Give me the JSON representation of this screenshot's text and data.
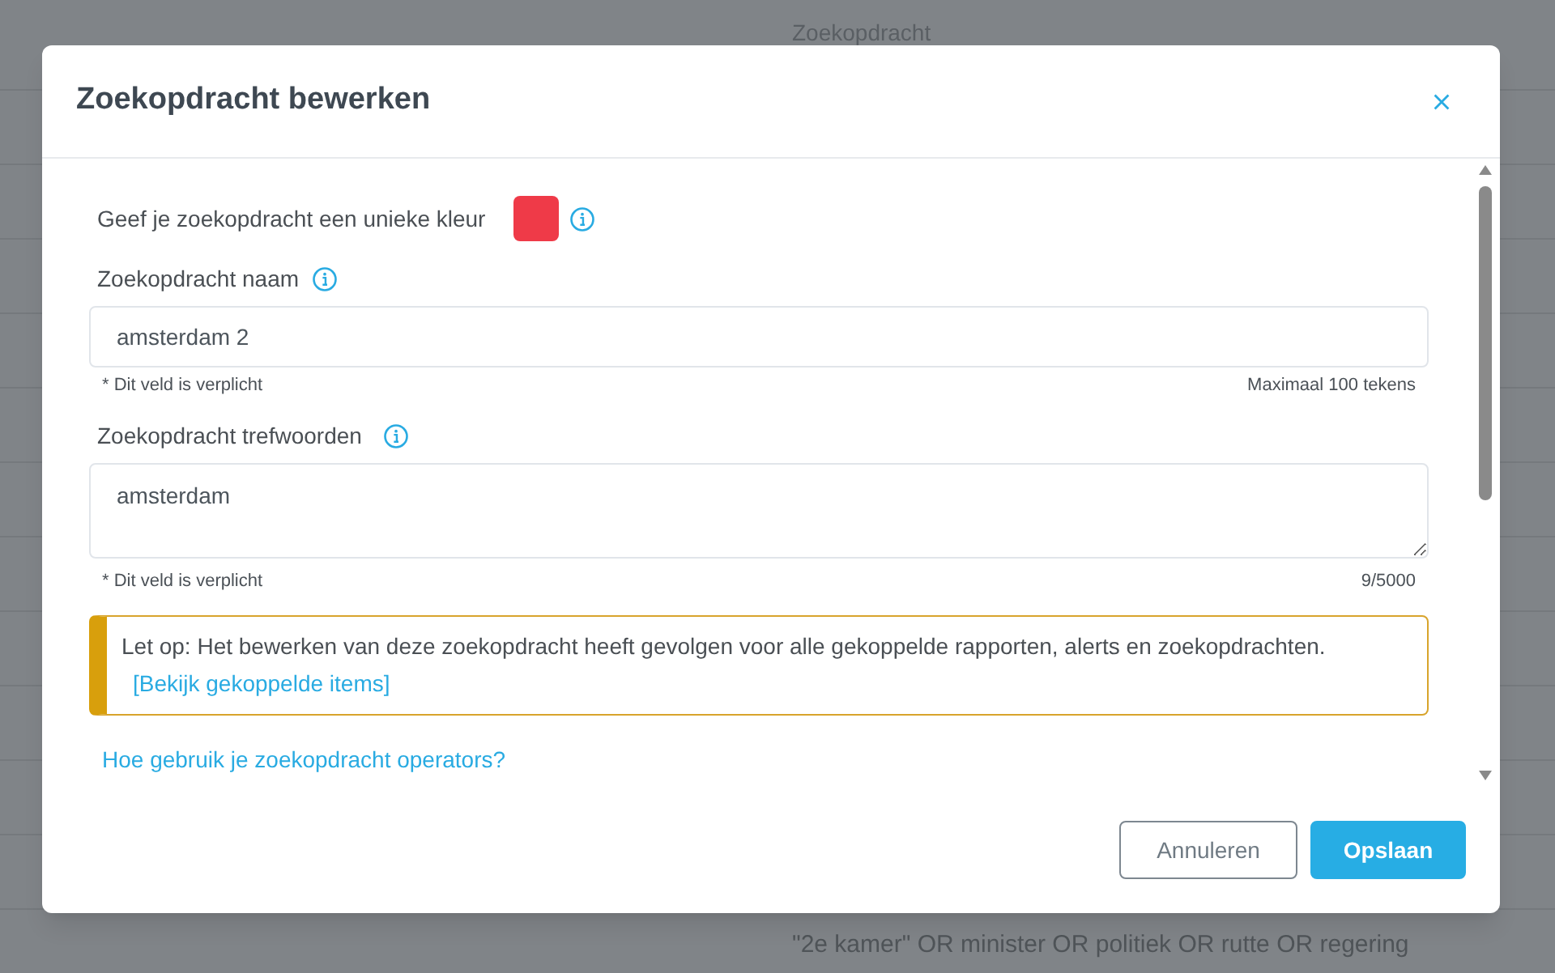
{
  "background_table": {
    "column_header": "Zoekopdracht",
    "rows": [
      {
        "zoekopdracht": "\"2e kamer\" OR minister OR politiek OR rutte OR regering"
      }
    ]
  },
  "dialog": {
    "title": "Zoekopdracht bewerken"
  },
  "color_picker": {
    "label": "Geef je zoekopdracht een unieke kleur",
    "color": "#ef3a48"
  },
  "fields": [
    {
      "kind": "input",
      "label": "Zoekopdracht naam",
      "value": "amsterdam 2",
      "required_note": "* Dit veld is verplicht",
      "counter": "Maximaal 100 tekens"
    },
    {
      "kind": "textarea",
      "label": "Zoekopdracht trefwoorden",
      "value": "amsterdam",
      "required_note": "* Dit veld is verplicht",
      "counter": "9/5000"
    }
  ],
  "alert": {
    "text": "Let op: Het bewerken van deze zoekopdracht heeft gevolgen voor alle gekoppelde rapporten, alerts en zoekopdrachten.",
    "link": "[Bekijk gekoppelde items]"
  },
  "help_link": "Hoe gebruik je zoekopdracht operators?",
  "buttons": [
    {
      "label": "Annuleren",
      "kind": "secondary"
    },
    {
      "label": "Opslaan",
      "kind": "primary"
    }
  ]
}
